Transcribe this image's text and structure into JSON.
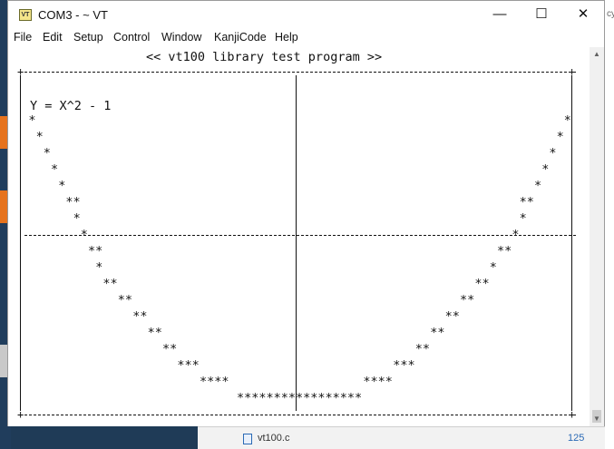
{
  "window": {
    "icon_text": "VT",
    "title": "COM3 - ~ VT",
    "minimize_glyph": "—",
    "maximize_glyph": "☐",
    "close_glyph": "✕"
  },
  "menu": [
    "File",
    "Edit",
    "Setup",
    "Control",
    "Window",
    "KanjiCode",
    "Help"
  ],
  "terminal": {
    "header": "<< vt100 library test program >>",
    "formula": "Y = X^2 - 1",
    "plot_char": "*"
  },
  "desktop": {
    "right_edge_text": "cy",
    "taskbar_file": "vt100.c",
    "taskbar_number": "125"
  },
  "colors": {
    "window_bg": "#ffffff",
    "terminal_text": "#111111",
    "desktop_bg": "#1f3b57"
  }
}
